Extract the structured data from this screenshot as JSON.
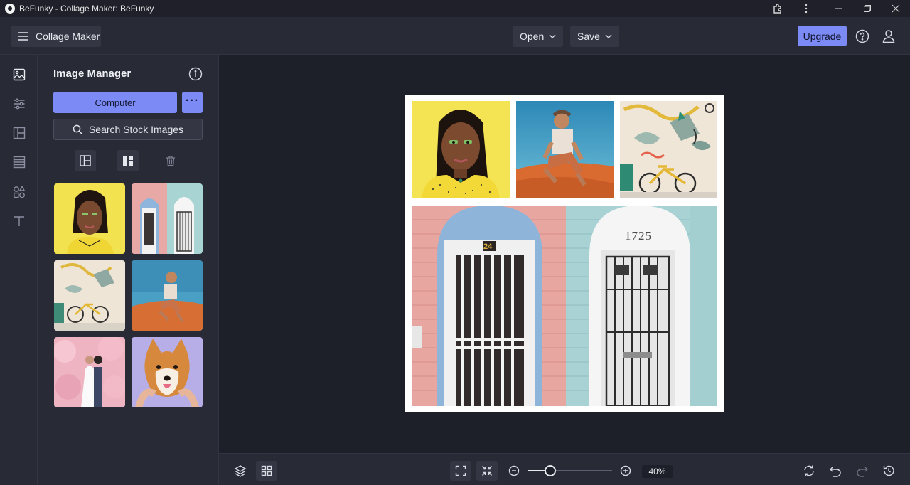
{
  "window": {
    "title": "BeFunky - Collage Maker: BeFunky"
  },
  "header": {
    "menu_label": "Collage Maker",
    "open_label": "Open",
    "save_label": "Save",
    "upgrade_label": "Upgrade"
  },
  "rail": {
    "items": [
      {
        "icon": "image-icon",
        "active": true
      },
      {
        "icon": "sliders-icon",
        "active": false
      },
      {
        "icon": "layout-icon",
        "active": false
      },
      {
        "icon": "texture-icon",
        "active": false
      },
      {
        "icon": "shapes-icon",
        "active": false
      },
      {
        "icon": "text-icon",
        "active": false
      }
    ]
  },
  "panel": {
    "title": "Image Manager",
    "computer_label": "Computer",
    "more_label": "···",
    "search_label": "Search Stock Images",
    "thumbnails": [
      {
        "subject": "woman-yellow-background"
      },
      {
        "subject": "pink-and-blue-doors"
      },
      {
        "subject": "bicycle-mural"
      },
      {
        "subject": "man-sitting-on-sand"
      },
      {
        "subject": "couple-cherry-blossoms"
      },
      {
        "subject": "shiba-dog-purple"
      }
    ]
  },
  "canvas": {
    "door_number_left": "24",
    "door_number_right": "1725"
  },
  "bottom": {
    "zoom_percent": 40,
    "zoom_label": "40%"
  },
  "colors": {
    "accent": "#7b8af5",
    "background": "#1e2029",
    "panel": "#282a36"
  }
}
